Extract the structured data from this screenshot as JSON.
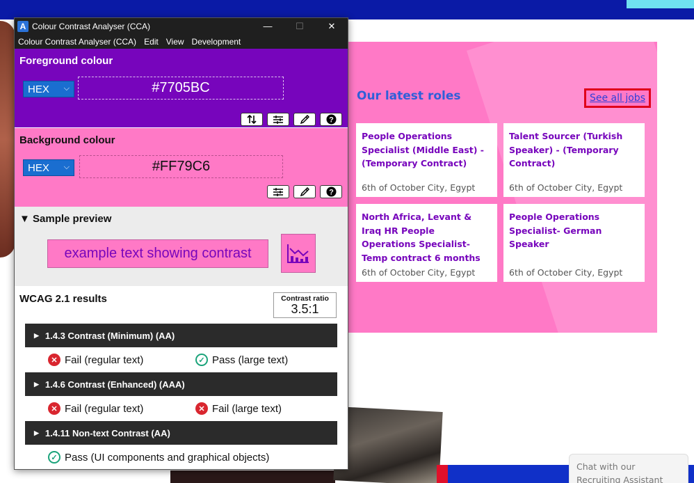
{
  "cca": {
    "title": "Colour Contrast Analyser (CCA)",
    "window_controls": {
      "minimize": "—",
      "maximize": "☐",
      "close": "✕"
    },
    "menu": [
      "Colour Contrast Analyser (CCA)",
      "Edit",
      "View",
      "Development"
    ],
    "foreground": {
      "heading": "Foreground colour",
      "format": "HEX",
      "value": "#7705BC",
      "color": "#7705bc"
    },
    "background": {
      "heading": "Background colour",
      "format": "HEX",
      "value": "#FF79C6",
      "color": "#ff79c6"
    },
    "preview": {
      "heading": "▼ Sample preview",
      "sample_text": "example text showing contrast"
    },
    "results": {
      "heading": "WCAG 2.1 results",
      "ratio_label": "Contrast ratio",
      "ratio_value": "3.5:1",
      "criteria": [
        {
          "label": "1.4.3 Contrast (Minimum) (AA)",
          "results": [
            "Fail (regular text)",
            "Pass (large text)"
          ]
        },
        {
          "label": "1.4.6 Contrast (Enhanced) (AAA)",
          "results": [
            "Fail (regular text)",
            "Fail (large text)"
          ]
        },
        {
          "label": "1.4.11 Non-text Contrast (AA)",
          "results": [
            "Pass (UI components and graphical objects)"
          ]
        }
      ]
    }
  },
  "site": {
    "roles_title": "Our latest roles",
    "see_all": "See all jobs",
    "jobs": [
      {
        "title": "People Operations Specialist (Middle East) - (Temporary Contract)",
        "location": "6th of October City, Egypt"
      },
      {
        "title": "Talent Sourcer (Turkish Speaker) - (Temporary Contract)",
        "location": "6th of October City, Egypt"
      },
      {
        "title": "North Africa, Levant & Iraq HR People Operations Specialist- Temp contract 6 months",
        "location": "6th of October City, Egypt"
      },
      {
        "title": "People Operations Specialist- German Speaker",
        "location": "6th of October City, Egypt"
      }
    ],
    "chat": "Chat with our Recruiting Assistant"
  }
}
